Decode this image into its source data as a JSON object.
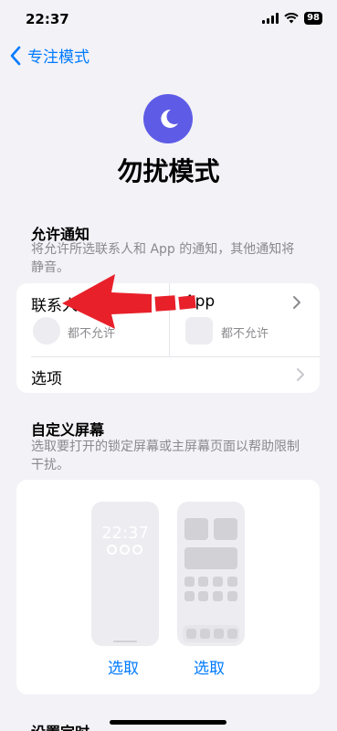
{
  "status_bar": {
    "time": "22:37",
    "battery": "98"
  },
  "nav": {
    "back_label": "专注模式"
  },
  "header": {
    "title": "勿扰模式",
    "icon": "moon-icon"
  },
  "allow_notifications": {
    "title": "允许通知",
    "description": "将允许所选联系人和 App 的通知，其他通知将静音。",
    "people": {
      "label": "联系人",
      "status": "都不允许"
    },
    "apps": {
      "label": "App",
      "status": "都不允许"
    },
    "options_label": "选项"
  },
  "custom_screens": {
    "title": "自定义屏幕",
    "description": "选取要打开的锁定屏幕或主屏幕页面以帮助限制干扰。",
    "lock_screen_time": "22:37",
    "lock_choose": "选取",
    "home_choose": "选取"
  },
  "next_section": {
    "title": "设置定时"
  },
  "colors": {
    "accent": "#007aff",
    "moon_badge": "#5e5ce6",
    "arrow": "#e8202a"
  }
}
